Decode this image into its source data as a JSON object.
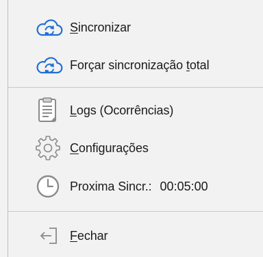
{
  "menu": {
    "items": [
      {
        "id": "sync",
        "icon": "cloud-sync-icon",
        "pre": "",
        "accel": "S",
        "post": "incronizar"
      },
      {
        "id": "force-sync",
        "icon": "cloud-sync-icon",
        "pre": "Forçar sincronização ",
        "accel": "t",
        "post": "otal"
      },
      {
        "id": "logs",
        "icon": "clipboard-icon",
        "pre": "",
        "accel": "L",
        "post": "ogs (Ocorrências)"
      },
      {
        "id": "config",
        "icon": "gear-icon",
        "pre": "",
        "accel": "C",
        "post": "onfigurações"
      },
      {
        "id": "next-sync",
        "icon": "clock-icon",
        "label": "Proxima Sincr.:",
        "time": "00:05:00"
      },
      {
        "id": "close",
        "icon": "exit-arrow-icon",
        "pre": "",
        "accel": "F",
        "post": "echar"
      }
    ]
  },
  "colors": {
    "background": "#f2f2f2",
    "cloud_icon": "#1f6fd6",
    "gray_icon": "#8a8a8a",
    "separator": "#c8c8c8"
  }
}
